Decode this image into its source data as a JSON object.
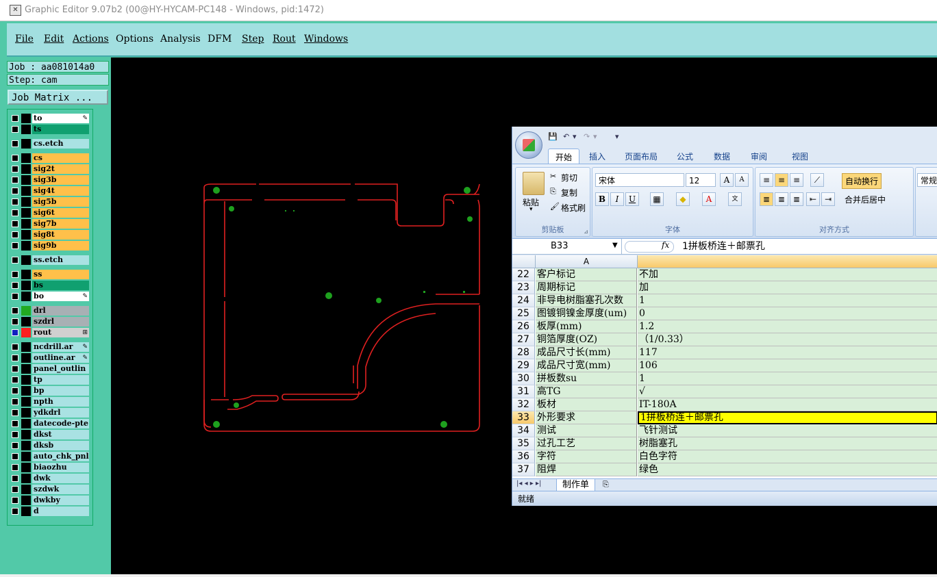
{
  "window": {
    "title": "Graphic Editor 9.07b2 (00@HY-HYCAM-PC148 - Windows, pid:1472)"
  },
  "menu": [
    "File",
    "Edit",
    "Actions",
    "Options",
    "Analysis",
    "DFM",
    "Step",
    "Rout",
    "Windows"
  ],
  "info": {
    "job": "Job : aa081014a0",
    "step": "Step: cam",
    "job_matrix": "Job Matrix ..."
  },
  "layers": [
    {
      "name": "to",
      "color": "#ffffff",
      "icon": "brush-icon"
    },
    {
      "name": "ts",
      "color": "#10a070"
    },
    {
      "name": "cs.etch",
      "color": "#a9e2e3"
    },
    {
      "name": "cs",
      "color": "#ffc04a"
    },
    {
      "name": "sig2t",
      "color": "#ffc04a"
    },
    {
      "name": "sig3b",
      "color": "#ffc04a"
    },
    {
      "name": "sig4t",
      "color": "#ffc04a"
    },
    {
      "name": "sig5b",
      "color": "#ffc04a"
    },
    {
      "name": "sig6t",
      "color": "#ffc04a"
    },
    {
      "name": "sig7b",
      "color": "#ffc04a"
    },
    {
      "name": "sig8t",
      "color": "#ffc04a"
    },
    {
      "name": "sig9b",
      "color": "#ffc04a"
    },
    {
      "name": "ss.etch",
      "color": "#a9e2e3"
    },
    {
      "name": "ss",
      "color": "#ffc04a"
    },
    {
      "name": "bs",
      "color": "#10a070"
    },
    {
      "name": "bo",
      "color": "#ffffff",
      "icon": "brush-icon"
    },
    {
      "name": "drl",
      "color": "#a8b0b4",
      "swatch": "#22aa22"
    },
    {
      "name": "szdrl",
      "color": "#a8b0b4"
    },
    {
      "name": "rout",
      "color": "#d0d0d0",
      "swatch": "#ff2020",
      "icon": "grid-icon",
      "highlight": true
    },
    {
      "name": "ncdrill.ar",
      "color": "#a9e2e3",
      "icon": "brush-icon"
    },
    {
      "name": "outline.ar",
      "color": "#a9e2e3",
      "icon": "brush-icon"
    },
    {
      "name": "panel_outlin",
      "color": "#a9e2e3"
    },
    {
      "name": "tp",
      "color": "#a9e2e3"
    },
    {
      "name": "bp",
      "color": "#a9e2e3"
    },
    {
      "name": "npth",
      "color": "#a9e2e3"
    },
    {
      "name": "ydkdrl",
      "color": "#a9e2e3"
    },
    {
      "name": "datecode-pte",
      "color": "#a9e2e3"
    },
    {
      "name": "dkst",
      "color": "#a9e2e3"
    },
    {
      "name": "dksb",
      "color": "#a9e2e3"
    },
    {
      "name": "auto_chk_pnl",
      "color": "#a9e2e3"
    },
    {
      "name": "biaozhu",
      "color": "#a9e2e3"
    },
    {
      "name": "dwk",
      "color": "#a9e2e3"
    },
    {
      "name": "szdwk",
      "color": "#a9e2e3"
    },
    {
      "name": "dwkby",
      "color": "#a9e2e3"
    },
    {
      "name": "d",
      "color": "#a9e2e3"
    }
  ],
  "excel": {
    "tabs": [
      "开始",
      "插入",
      "页面布局",
      "公式",
      "数据",
      "审阅",
      "视图"
    ],
    "clipboard": {
      "paste": "粘贴",
      "cut": "剪切",
      "copy": "复制",
      "format_painter": "格式刷",
      "label": "剪贴板"
    },
    "font": {
      "name": "宋体",
      "size": "12",
      "label": "字体"
    },
    "align": {
      "wrap": "自动换行",
      "merge": "合并后居中",
      "label": "对齐方式"
    },
    "number": {
      "format": "常规"
    },
    "formula_bar": {
      "cell": "B33",
      "fx": "fx",
      "value": "1拼板桥连＋邮票孔"
    },
    "col_header": "A",
    "rows": [
      {
        "n": "22",
        "a": "客户标记",
        "b": "不加"
      },
      {
        "n": "23",
        "a": "周期标记",
        "b": "加"
      },
      {
        "n": "24",
        "a": "非导电树脂塞孔次数",
        "b": "1"
      },
      {
        "n": "25",
        "a": "图镀铜镍金厚度(um)",
        "b": "0"
      },
      {
        "n": "26",
        "a": "板厚(mm)",
        "b": "1.2"
      },
      {
        "n": "27",
        "a": "铜箔厚度(OZ)",
        "b": "（1/0.33）"
      },
      {
        "n": "28",
        "a": "成品尺寸长(mm)",
        "b": "117"
      },
      {
        "n": "29",
        "a": "成品尺寸宽(mm)",
        "b": "106"
      },
      {
        "n": "30",
        "a": "拼板数su",
        "b": "1"
      },
      {
        "n": "31",
        "a": "高TG",
        "b": "√"
      },
      {
        "n": "32",
        "a": "板材",
        "b": "IT-180A"
      },
      {
        "n": "33",
        "a": "外形要求",
        "b": "1拼板桥连＋邮票孔",
        "selected": true
      },
      {
        "n": "34",
        "a": "测试",
        "b": "飞针测试"
      },
      {
        "n": "35",
        "a": "过孔工艺",
        "b": "树脂塞孔"
      },
      {
        "n": "36",
        "a": "字符",
        "b": "白色字符"
      },
      {
        "n": "37",
        "a": "阻焊",
        "b": "绿色"
      }
    ],
    "sheet_tab": "制作单",
    "status": "就绪"
  }
}
